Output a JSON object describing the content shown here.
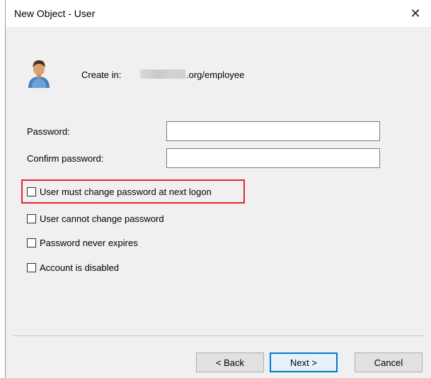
{
  "window": {
    "title": "New Object - User",
    "close_glyph": "✕"
  },
  "header": {
    "icon": "user-icon",
    "create_in_label": "Create in:",
    "path_suffix": ".org/employee"
  },
  "form": {
    "password_label": "Password:",
    "password_value": "",
    "confirm_label": "Confirm password:",
    "confirm_value": ""
  },
  "options": [
    {
      "label": "User must change password at next logon",
      "checked": false,
      "highlighted": true
    },
    {
      "label": "User cannot change password",
      "checked": false
    },
    {
      "label": "Password never expires",
      "checked": false
    },
    {
      "label": "Account is disabled",
      "checked": false
    }
  ],
  "buttons": {
    "back": "< Back",
    "next": "Next >",
    "cancel": "Cancel"
  },
  "colors": {
    "highlight": "#e0262f",
    "default_button_border": "#0078d7"
  }
}
